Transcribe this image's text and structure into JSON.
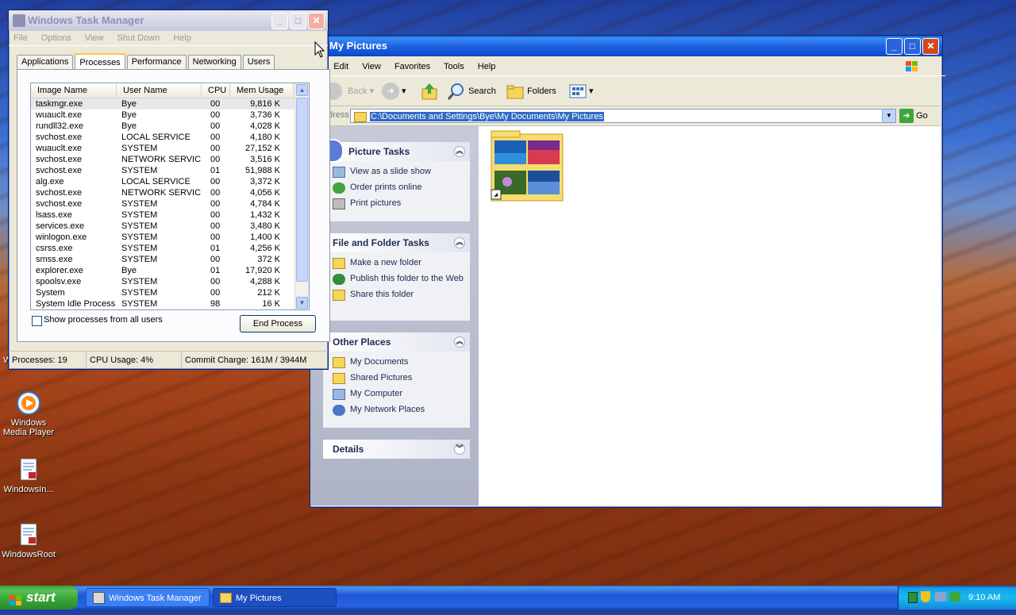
{
  "desktop": {
    "icons": [
      {
        "label": "Windows Media Player",
        "line1": "Windows",
        "line2": "Media Player"
      },
      {
        "label": "WindowsIn..."
      },
      {
        "label": "WindowsRoot"
      }
    ],
    "partial_icon_letter": "W"
  },
  "taskmgr": {
    "title": "Windows Task Manager",
    "menu": [
      "File",
      "Options",
      "View",
      "Shut Down",
      "Help"
    ],
    "tabs": [
      "Applications",
      "Processes",
      "Performance",
      "Networking",
      "Users"
    ],
    "selected_tab": "Processes",
    "columns": [
      "Image Name",
      "User Name",
      "CPU",
      "Mem Usage"
    ],
    "rows": [
      {
        "name": "taskmgr.exe",
        "user": "Bye",
        "cpu": "00",
        "mem": "9,816 K"
      },
      {
        "name": "wuauclt.exe",
        "user": "Bye",
        "cpu": "00",
        "mem": "3,736 K"
      },
      {
        "name": "rundll32.exe",
        "user": "Bye",
        "cpu": "00",
        "mem": "4,028 K"
      },
      {
        "name": "svchost.exe",
        "user": "LOCAL SERVICE",
        "cpu": "00",
        "mem": "4,180 K"
      },
      {
        "name": "wuauclt.exe",
        "user": "SYSTEM",
        "cpu": "00",
        "mem": "27,152 K"
      },
      {
        "name": "svchost.exe",
        "user": "NETWORK SERVICE",
        "cpu": "00",
        "mem": "3,516 K"
      },
      {
        "name": "svchost.exe",
        "user": "SYSTEM",
        "cpu": "01",
        "mem": "51,988 K"
      },
      {
        "name": "alg.exe",
        "user": "LOCAL SERVICE",
        "cpu": "00",
        "mem": "3,372 K"
      },
      {
        "name": "svchost.exe",
        "user": "NETWORK SERVICE",
        "cpu": "00",
        "mem": "4,056 K"
      },
      {
        "name": "svchost.exe",
        "user": "SYSTEM",
        "cpu": "00",
        "mem": "4,784 K"
      },
      {
        "name": "lsass.exe",
        "user": "SYSTEM",
        "cpu": "00",
        "mem": "1,432 K"
      },
      {
        "name": "services.exe",
        "user": "SYSTEM",
        "cpu": "00",
        "mem": "3,480 K"
      },
      {
        "name": "winlogon.exe",
        "user": "SYSTEM",
        "cpu": "00",
        "mem": "1,400 K"
      },
      {
        "name": "csrss.exe",
        "user": "SYSTEM",
        "cpu": "01",
        "mem": "4,256 K"
      },
      {
        "name": "smss.exe",
        "user": "SYSTEM",
        "cpu": "00",
        "mem": "372 K"
      },
      {
        "name": "explorer.exe",
        "user": "Bye",
        "cpu": "01",
        "mem": "17,920 K"
      },
      {
        "name": "spoolsv.exe",
        "user": "SYSTEM",
        "cpu": "00",
        "mem": "4,288 K"
      },
      {
        "name": "System",
        "user": "SYSTEM",
        "cpu": "00",
        "mem": "212 K"
      },
      {
        "name": "System Idle Process",
        "user": "SYSTEM",
        "cpu": "98",
        "mem": "16 K"
      }
    ],
    "show_all_label": "Show processes from all users",
    "end_process_label": "End Process",
    "status": {
      "processes": "Processes: 19",
      "cpu": "CPU Usage: 4%",
      "commit": "Commit Charge: 161M / 3944M"
    }
  },
  "explorer": {
    "title": "My Pictures",
    "menu": [
      "e",
      "Edit",
      "View",
      "Favorites",
      "Tools",
      "Help"
    ],
    "toolbar": {
      "back": "Back",
      "search": "Search",
      "folders": "Folders"
    },
    "address_label": "dress",
    "address_value": "C:\\Documents and Settings\\Bye\\My Documents\\My Pictures",
    "go_label": "Go",
    "panels": [
      {
        "title": "Picture Tasks",
        "items": [
          "View as a slide show",
          "Order prints online",
          "Print pictures"
        ]
      },
      {
        "title": "File and Folder Tasks",
        "items": [
          "Make a new folder",
          "Publish this folder to the Web",
          "Share this folder"
        ]
      },
      {
        "title": "Other Places",
        "items": [
          "My Documents",
          "Shared Pictures",
          "My Computer",
          "My Network Places"
        ]
      },
      {
        "title": "Details",
        "items": []
      }
    ]
  },
  "taskbar": {
    "start_label": "start",
    "buttons": [
      "Windows Task Manager",
      "My Pictures"
    ],
    "clock": "9:10 AM"
  },
  "colors": {
    "xp_blue": "#0e4fd4",
    "start_green": "#36a336",
    "taskpane_blue": "#6375d6"
  }
}
